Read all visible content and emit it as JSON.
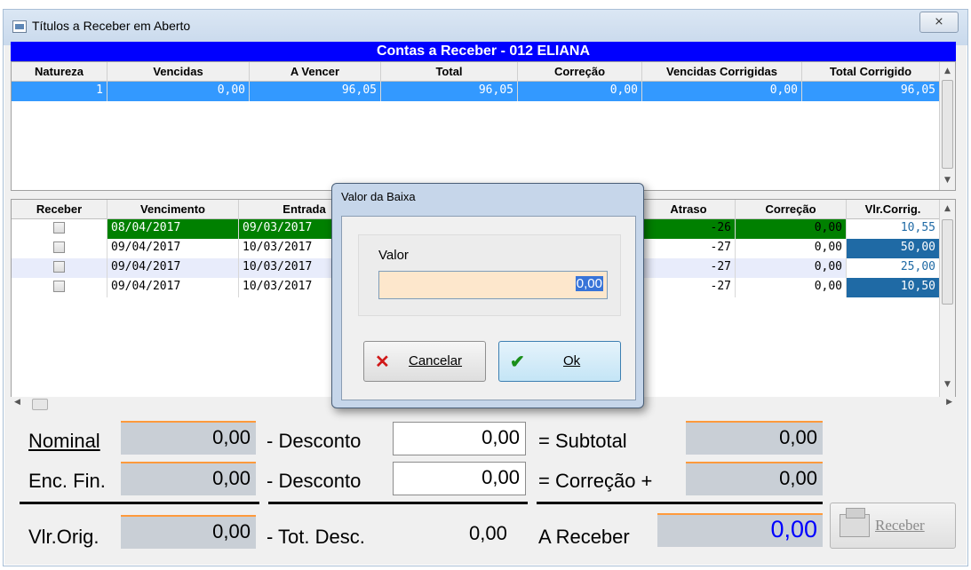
{
  "window": {
    "title": "Títulos a Receber em Aberto",
    "close_glyph": "⨯"
  },
  "summary_grid": {
    "caption": "Contas a Receber - 012 ELIANA",
    "columns": [
      "Natureza",
      "Vencidas",
      "A Vencer",
      "Total",
      "Correção",
      "Vencidas Corrigidas",
      "Total Corrigido"
    ],
    "rows": [
      [
        "1",
        "0,00",
        "96,05",
        "96,05",
        "0,00",
        "0,00",
        "96,05"
      ]
    ]
  },
  "detail_grid": {
    "columns": [
      "Receber",
      "Vencimento",
      "Entrada",
      "Atraso",
      "Correção",
      "Vlr.Corrig."
    ],
    "rows": [
      {
        "vencimento": "08/04/2017",
        "entrada": "09/03/2017",
        "atraso": "-26",
        "correcao": "0,00",
        "vlr": "10,55"
      },
      {
        "vencimento": "09/04/2017",
        "entrada": "10/03/2017",
        "atraso": "-27",
        "correcao": "0,00",
        "vlr": "50,00"
      },
      {
        "vencimento": "09/04/2017",
        "entrada": "10/03/2017",
        "atraso": "-27",
        "correcao": "0,00",
        "vlr": "25,00"
      },
      {
        "vencimento": "09/04/2017",
        "entrada": "10/03/2017",
        "atraso": "-27",
        "correcao": "0,00",
        "vlr": "10,50"
      }
    ]
  },
  "totals": {
    "nominal_label": "Nominal",
    "nominal_value": "0,00",
    "enc_fin_label": "Enc. Fin.",
    "enc_fin_value": "0,00",
    "vlr_orig_label": "Vlr.Orig.",
    "vlr_orig_value": "0,00",
    "desconto1_label": "- Desconto",
    "desconto1_value": "0,00",
    "desconto2_label": "- Desconto",
    "desconto2_value": "0,00",
    "tot_desc_label": "- Tot. Desc.",
    "tot_desc_value": "0,00",
    "subtotal_label": "= Subtotal",
    "subtotal_value": "0,00",
    "correcao_label": "= Correção +",
    "correcao_value": "0,00",
    "a_receber_label": "A Receber",
    "a_receber_value": "0,00",
    "receber_button": "Receber"
  },
  "dialog": {
    "title": "Valor da Baixa",
    "field_label": "Valor",
    "field_value": "0,00",
    "cancel_label": "Cancelar",
    "ok_label": "Ok"
  },
  "colors": {
    "caption_blue": "#0000ff",
    "selected_row": "#3399ff",
    "overdue_row": "#008000",
    "value_highlight": "#1f6aa5",
    "a_receber_value": "#0000ff"
  }
}
